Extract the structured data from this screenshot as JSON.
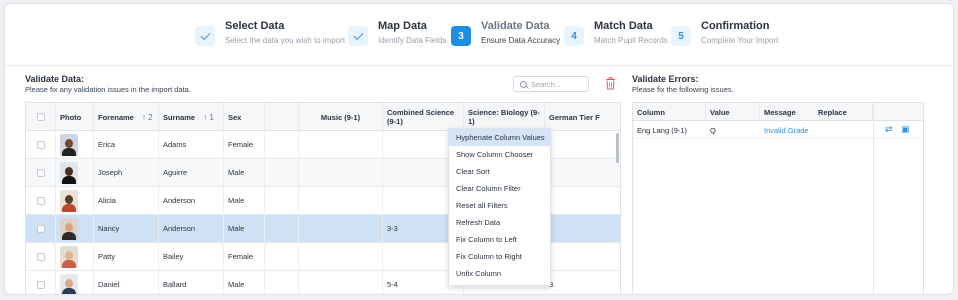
{
  "stepper": {
    "steps": [
      {
        "badge": "",
        "title": "Select Data",
        "sub": "Select the data you wish to import",
        "state": "done"
      },
      {
        "badge": "",
        "title": "Map Data",
        "sub": "Identify Data Fields",
        "state": "done"
      },
      {
        "badge": "3",
        "title": "Validate Data",
        "sub": "Ensure Data Accuracy",
        "state": "active"
      },
      {
        "badge": "4",
        "title": "Match Data",
        "sub": "Match Pupil Records",
        "state": "todo"
      },
      {
        "badge": "5",
        "title": "Confirmation",
        "sub": "Complete Your Import",
        "state": "todo"
      }
    ]
  },
  "validate": {
    "title": "Validate Data:",
    "sub": "Please fix any validation issues in the import data.",
    "search_placeholder": "Search...",
    "columns": {
      "photo": "Photo",
      "forename": "Forename",
      "forename_sort": "↑ 2",
      "surname": "Surname",
      "surname_sort": "↑ 1",
      "sex": "Sex",
      "music": "Music (9-1)",
      "combined": "Combined Science (9-1)",
      "biology": "Science: Biology (9-1)",
      "german": "German Tier F"
    },
    "rows": [
      {
        "forename": "Erica",
        "surname": "Adams",
        "sex": "Female",
        "combined": "",
        "german": ""
      },
      {
        "forename": "Joseph",
        "surname": "Aguirre",
        "sex": "Male",
        "combined": "",
        "german": ""
      },
      {
        "forename": "Alicia",
        "surname": "Anderson",
        "sex": "Male",
        "combined": "",
        "german": ""
      },
      {
        "forename": "Nancy",
        "surname": "Anderson",
        "sex": "Male",
        "combined": "3-3",
        "german": ""
      },
      {
        "forename": "Patty",
        "surname": "Bailey",
        "sex": "Female",
        "combined": "",
        "german": ""
      },
      {
        "forename": "Daniel",
        "surname": "Ballard",
        "sex": "Male",
        "combined": "5-4",
        "german": "3"
      }
    ]
  },
  "menu": {
    "items": [
      "Hyphenate Column Values",
      "Show Column Chooser",
      "Clear Sort",
      "Clear Column Filter",
      "Reset all Filters",
      "Refresh Data",
      "Fix Column to Left",
      "Fix Column to Right",
      "Unfix Column"
    ]
  },
  "errors": {
    "title": "Validate Errors:",
    "sub": "Please fix the following issues.",
    "columns": {
      "column": "Column",
      "value": "Value",
      "message": "Message",
      "replace": "Replace"
    },
    "rows": [
      {
        "column": "Eng Lang (9-1)",
        "value": "Q",
        "message": "Invalid Grade",
        "replace": ""
      }
    ]
  },
  "colors": {
    "accent": "#1e8fe0",
    "selected_row": "#cfe2f5",
    "danger": "#e05a5a"
  }
}
